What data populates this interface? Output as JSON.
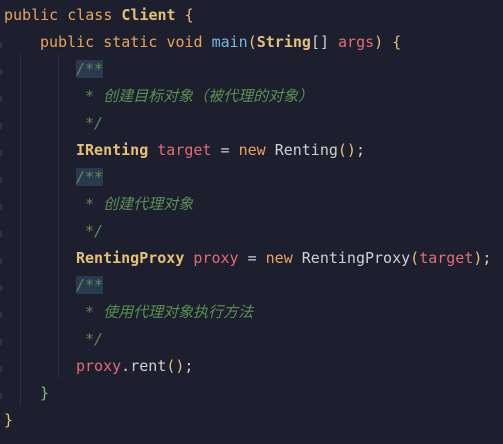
{
  "code": {
    "class_keyword_public": "public",
    "class_keyword_class": "class",
    "class_name": "Client",
    "method_public": "public",
    "method_static": "static",
    "method_void": "void",
    "method_name": "main",
    "param_type": "String",
    "param_array": "[]",
    "param_name": "args",
    "comment_open": "/**",
    "comment_close": "*/",
    "comment_1": " * 创建目标对象（被代理的对象）",
    "comment_2": " * 创建代理对象",
    "comment_3": " * 使用代理对象执行方法",
    "target_type": "IRenting",
    "target_var": "target",
    "kw_new": "new",
    "target_ctor": "Renting",
    "proxy_type": "RentingProxy",
    "proxy_var": "proxy",
    "proxy_ctor": "RentingProxy",
    "proxy_arg": "target",
    "call_obj": "proxy",
    "call_method": "rent"
  }
}
